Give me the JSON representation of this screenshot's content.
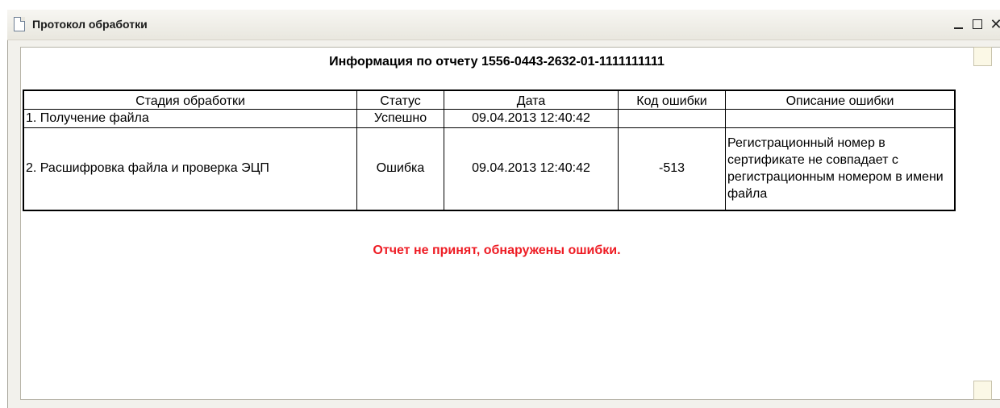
{
  "window": {
    "title": "Протокол обработки",
    "buttons": {
      "minimize": "_",
      "maximize": "□",
      "close": "✕"
    }
  },
  "report": {
    "heading": "Информация по отчету 1556-0443-2632-01-1111111111",
    "columns": [
      "Стадия обработки",
      "Статус",
      "Дата",
      "Код ошибки",
      "Описание ошибки"
    ],
    "rows": [
      {
        "stage": "1. Получение файла",
        "status": "Успешно",
        "date": "09.04.2013 12:40:42",
        "code": "",
        "description": ""
      },
      {
        "stage": "2. Расшифровка файла и проверка ЭЦП",
        "status": "Ошибка",
        "date": "09.04.2013 12:40:42",
        "code": "-513",
        "description": "Регистрационный номер в сертификате не совпадает с регистрационным номером в имени файла"
      }
    ],
    "result_message": "Отчет не принят, обнаружены ошибки."
  },
  "colors": {
    "error_text": "#ee1c24",
    "titlebar": "#e9e7df",
    "scrollbar": "#fbf8e6"
  },
  "icons": {
    "title": "document-icon"
  }
}
